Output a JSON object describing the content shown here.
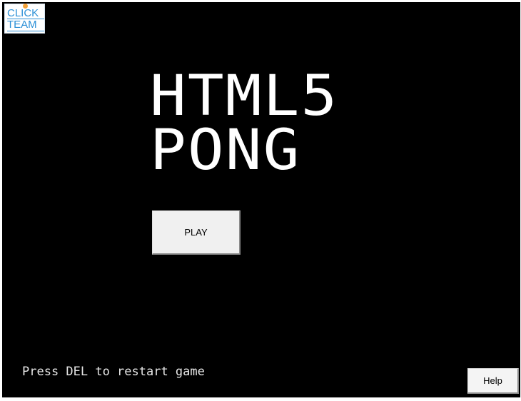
{
  "logo": {
    "line1": "CLICK",
    "line2": "TEAM",
    "color": "#2a8fd6",
    "dot_color": "#f2a23a"
  },
  "title": {
    "line1": "HTML5",
    "line2": "PONG"
  },
  "play_button": {
    "label": "PLAY"
  },
  "footer": {
    "restart_hint": "Press DEL to restart game",
    "help_label": "Help"
  },
  "colors": {
    "canvas_background": "#000000",
    "title_text": "#ffffff",
    "button_face": "#f0f0f0"
  }
}
